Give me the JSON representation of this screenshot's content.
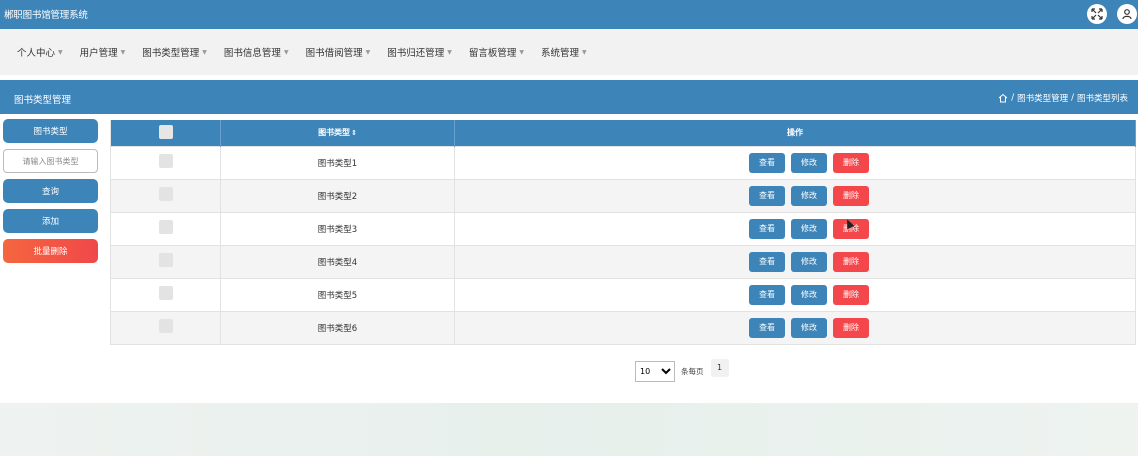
{
  "app": {
    "title": "郴职图书馆管理系统"
  },
  "header_icons": [
    {
      "icon": "fullscreen-icon"
    },
    {
      "icon": "user-icon"
    }
  ],
  "menu": [
    {
      "label": "个人中心"
    },
    {
      "label": "用户管理"
    },
    {
      "label": "图书类型管理"
    },
    {
      "label": "图书信息管理"
    },
    {
      "label": "图书借阅管理"
    },
    {
      "label": "图书归还管理"
    },
    {
      "label": "留言板管理"
    },
    {
      "label": "系统管理"
    }
  ],
  "banner": {
    "title": "图书类型管理",
    "breadcrumb": [
      "图书类型管理",
      "图书类型列表"
    ]
  },
  "sidebar": {
    "field_label": "图书类型",
    "search_placeholder": "请输入图书类型",
    "search_value": "",
    "query_label": "查询",
    "add_label": "添加",
    "batch_delete_label": "批量删除"
  },
  "table": {
    "columns": [
      "图书类型",
      "操作"
    ],
    "sort_indicator": "⇕",
    "rows": [
      {
        "name": "图书类型1"
      },
      {
        "name": "图书类型2"
      },
      {
        "name": "图书类型3"
      },
      {
        "name": "图书类型4"
      },
      {
        "name": "图书类型5"
      },
      {
        "name": "图书类型6"
      }
    ],
    "actions": {
      "view": "查看",
      "edit": "修改",
      "delete": "删除"
    }
  },
  "pagination": {
    "page_size": "10",
    "page_size_options": [
      "10"
    ],
    "per_page_label": "条每页",
    "current_page": "1"
  },
  "colors": {
    "primary": "#3d84b9",
    "danger": "#f4474b"
  }
}
